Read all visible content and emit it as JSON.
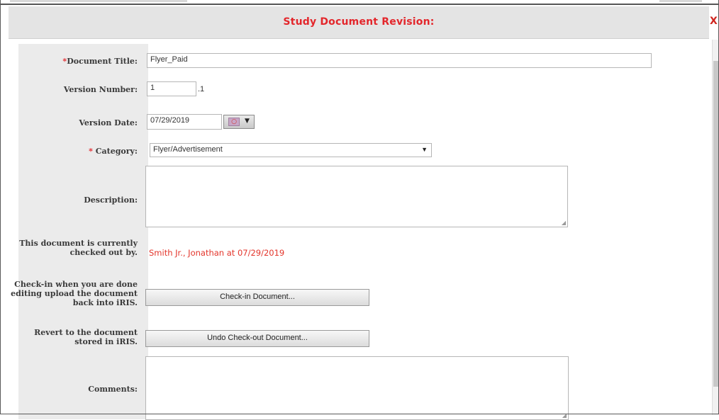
{
  "dialog": {
    "title": "Study Document Revision:",
    "close_label": "X"
  },
  "form": {
    "document_title": {
      "required_mark": "*",
      "label": "Document Title:",
      "value": "Flyer_Paid"
    },
    "version_number": {
      "label": "Version Number:",
      "value": "1",
      "suffix": ".1"
    },
    "version_date": {
      "label": "Version Date:",
      "value": "07/29/2019",
      "picker_icon": "calendar-icon"
    },
    "category": {
      "required_mark": "* ",
      "label": "Category:",
      "value": "Flyer/Advertisement"
    },
    "description": {
      "label": "Description:",
      "value": ""
    },
    "checked_out": {
      "label": "This document is currently checked out by.",
      "value": "Smith Jr., Jonathan at 07/29/2019"
    },
    "checkin": {
      "label": "Check-in when you are done editing upload the document back into iRIS.",
      "button": "Check-in Document..."
    },
    "revert": {
      "label": "Revert to the document stored in iRIS.",
      "button": "Undo Check-out Document..."
    },
    "comments": {
      "label": "Comments:",
      "value": ""
    }
  },
  "colors": {
    "accent_red": "#e3262b",
    "label_bg": "#ebebeb"
  }
}
